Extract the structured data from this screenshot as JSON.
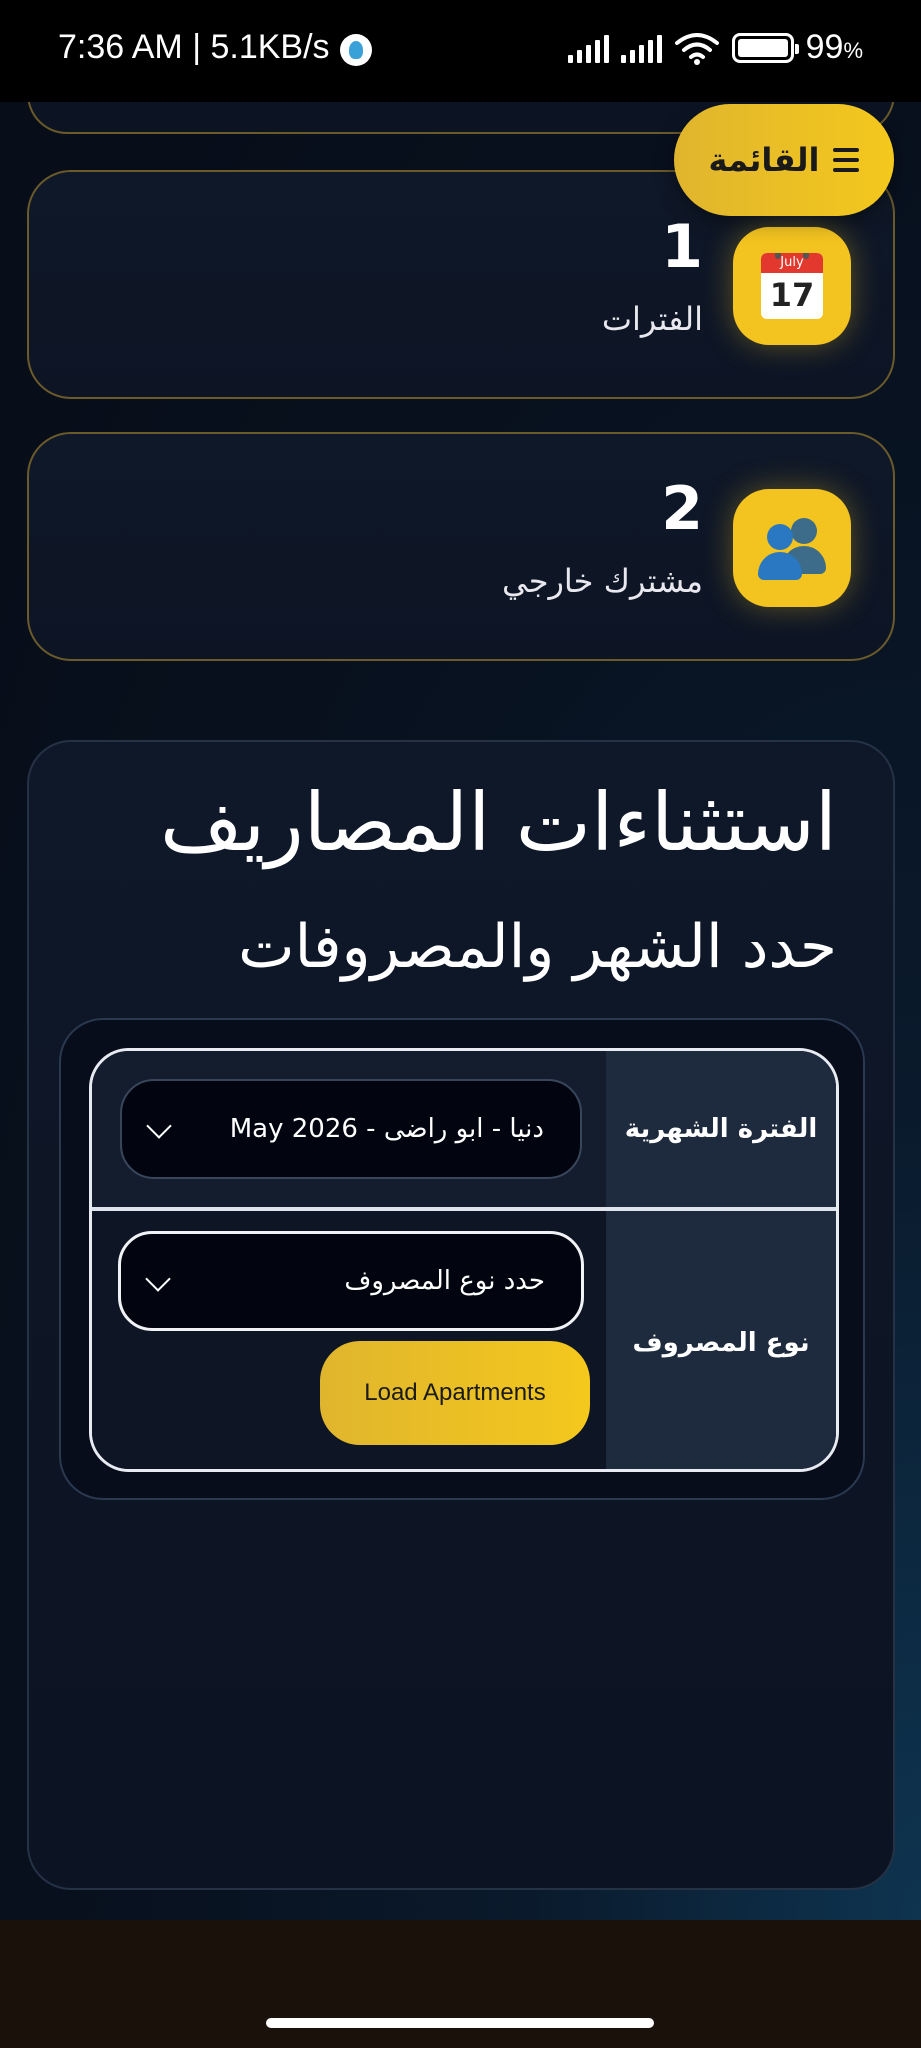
{
  "status_bar": {
    "time_speed": "7:36 AM | 5.1KB/s",
    "battery": "99",
    "battery_unit": "%"
  },
  "menu": {
    "label": "القائمة",
    "icon": "hamburger-icon"
  },
  "stats": [
    {
      "value": "1",
      "label": "الفترات",
      "icon": "calendar-icon",
      "calendar_month": "July",
      "calendar_day": "17"
    },
    {
      "value": "2",
      "label": "مشترك خارجي",
      "icon": "people-icon"
    }
  ],
  "panel": {
    "title": "استثناءات المصاريف",
    "subtitle": "حدد الشهر والمصروفات",
    "form": {
      "period_label": "الفترة الشهرية",
      "period_value": "دنيا - ابو راضى - May 2026",
      "expense_type_label": "نوع المصروف",
      "expense_type_placeholder": "حدد نوع المصروف",
      "load_button": "Load Apartments"
    }
  },
  "colors": {
    "accent": "#f3c320",
    "background": "#08111f",
    "card_border": "#6b5a2a"
  }
}
